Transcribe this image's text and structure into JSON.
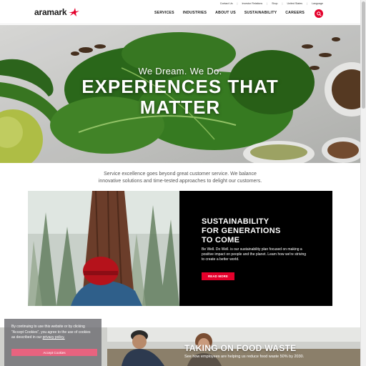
{
  "header": {
    "logo_text": "aramark",
    "utility_links": [
      "Contact Us",
      "Investor Relations",
      "Shop",
      "United States",
      "Language"
    ],
    "nav": [
      "SERVICES",
      "INDUSTRIES",
      "ABOUT US",
      "SUSTAINABILITY",
      "CAREERS"
    ],
    "search_icon": "search-icon"
  },
  "hero": {
    "subtitle": "We Dream. We Do.",
    "title_line1": "EXPERIENCES THAT",
    "title_line2": "MATTER"
  },
  "intro": {
    "line1": "Service excellence goes beyond great customer service. We balance",
    "line2": "innovative solutions and time-tested approaches to delight our customers."
  },
  "sustainability": {
    "title_line1": "SUSTAINABILITY",
    "title_line2": "FOR GENERATIONS",
    "title_line3": "TO COME",
    "body": "Be Well. Do Well. is our sustainability plan focused on making a positive impact on people and the planet. Learn how we're striving to create a better world.",
    "button": "READ MORE"
  },
  "food_waste": {
    "title": "TAKING ON FOOD WASTE",
    "body": "See how employees are helping us reduce food waste 50% by 2030."
  },
  "cookie": {
    "text": "By continuing to use this website or by clicking \"Accept Cookies\", you agree to the use of cookies as described in our",
    "link": "privacy policy.",
    "button": "Accept Cookies"
  },
  "colors": {
    "brand_red": "#e4002b",
    "dark_panel": "#000000",
    "cookie_button": "#e8637f"
  }
}
